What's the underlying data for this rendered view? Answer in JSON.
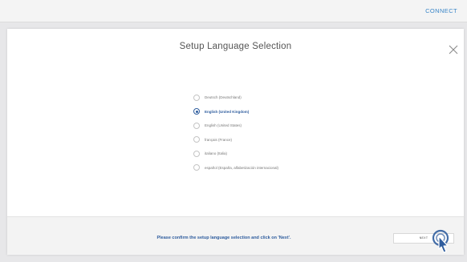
{
  "topbar": {
    "connect_label": "CONNECT"
  },
  "dialog": {
    "title": "Setup Language Selection",
    "close_icon": "close-icon",
    "options": [
      {
        "label": "Deutsch (Deutschland)",
        "checked": false
      },
      {
        "label": "English (United Kingdom)",
        "checked": true
      },
      {
        "label": "English (United States)",
        "checked": false
      },
      {
        "label": "français (France)",
        "checked": false
      },
      {
        "label": "italiano (Italia)",
        "checked": false
      },
      {
        "label": "español (España, alfabetización internacional)",
        "checked": false
      }
    ],
    "footer_message": "Please confirm the setup language selection and click on 'Next'.",
    "next_label": "NEXT"
  },
  "colors": {
    "accent": "#2f5d9e",
    "link": "#3a86c8",
    "background": "#e7e7e9"
  },
  "cursor_icon": "hand-pointer-icon"
}
